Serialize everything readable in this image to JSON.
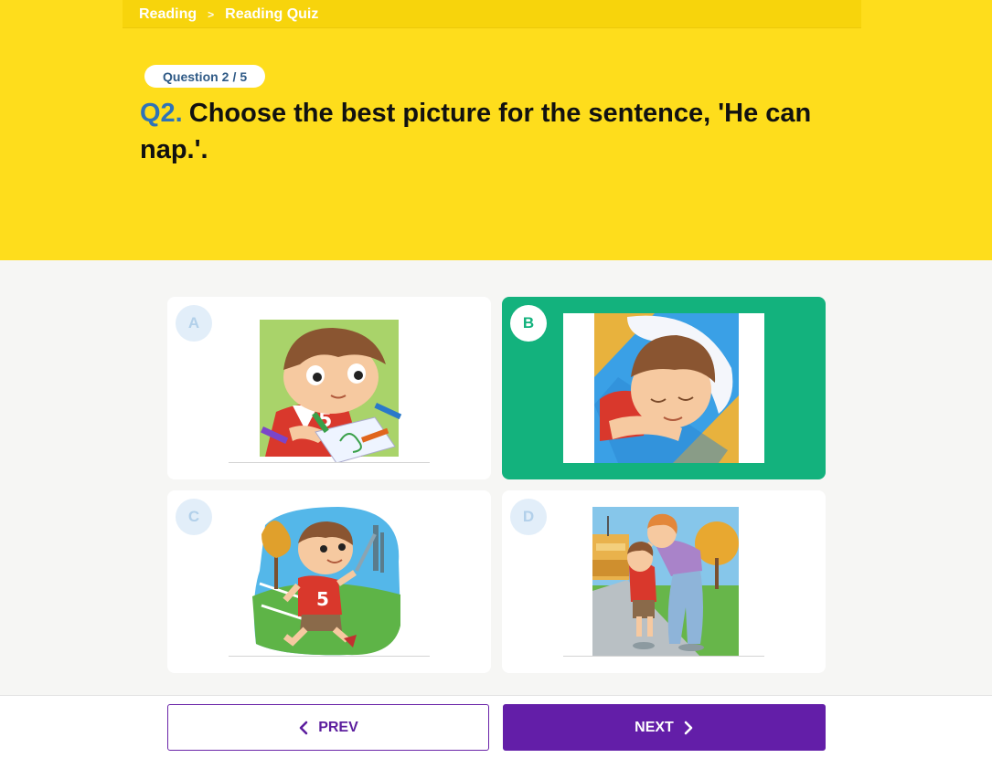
{
  "breadcrumb": {
    "items": [
      "Reading",
      "Reading Quiz"
    ],
    "separator": ">"
  },
  "question": {
    "badge_prefix": "Question",
    "current": "2",
    "separator": "/",
    "total": "5",
    "number_label": "Q2.",
    "text": "Choose the best picture for the sentence, 'He can nap.'."
  },
  "options": [
    {
      "letter": "A",
      "image": "boy-drawing-with-crayons",
      "selected": false
    },
    {
      "letter": "B",
      "image": "boy-napping-on-pillow",
      "selected": true
    },
    {
      "letter": "C",
      "image": "boy-running-in-park",
      "selected": false
    },
    {
      "letter": "D",
      "image": "mother-hugging-boy-at-school",
      "selected": false
    }
  ],
  "navigation": {
    "prev_label": "PREV",
    "next_label": "NEXT",
    "prev_icon": "chevron-left-icon",
    "next_icon": "chevron-right-icon"
  },
  "colors": {
    "header_yellow": "#fedd1c",
    "selected_green": "#13b27d",
    "question_blue": "#2f73b8",
    "button_purple": "#631ea8"
  }
}
